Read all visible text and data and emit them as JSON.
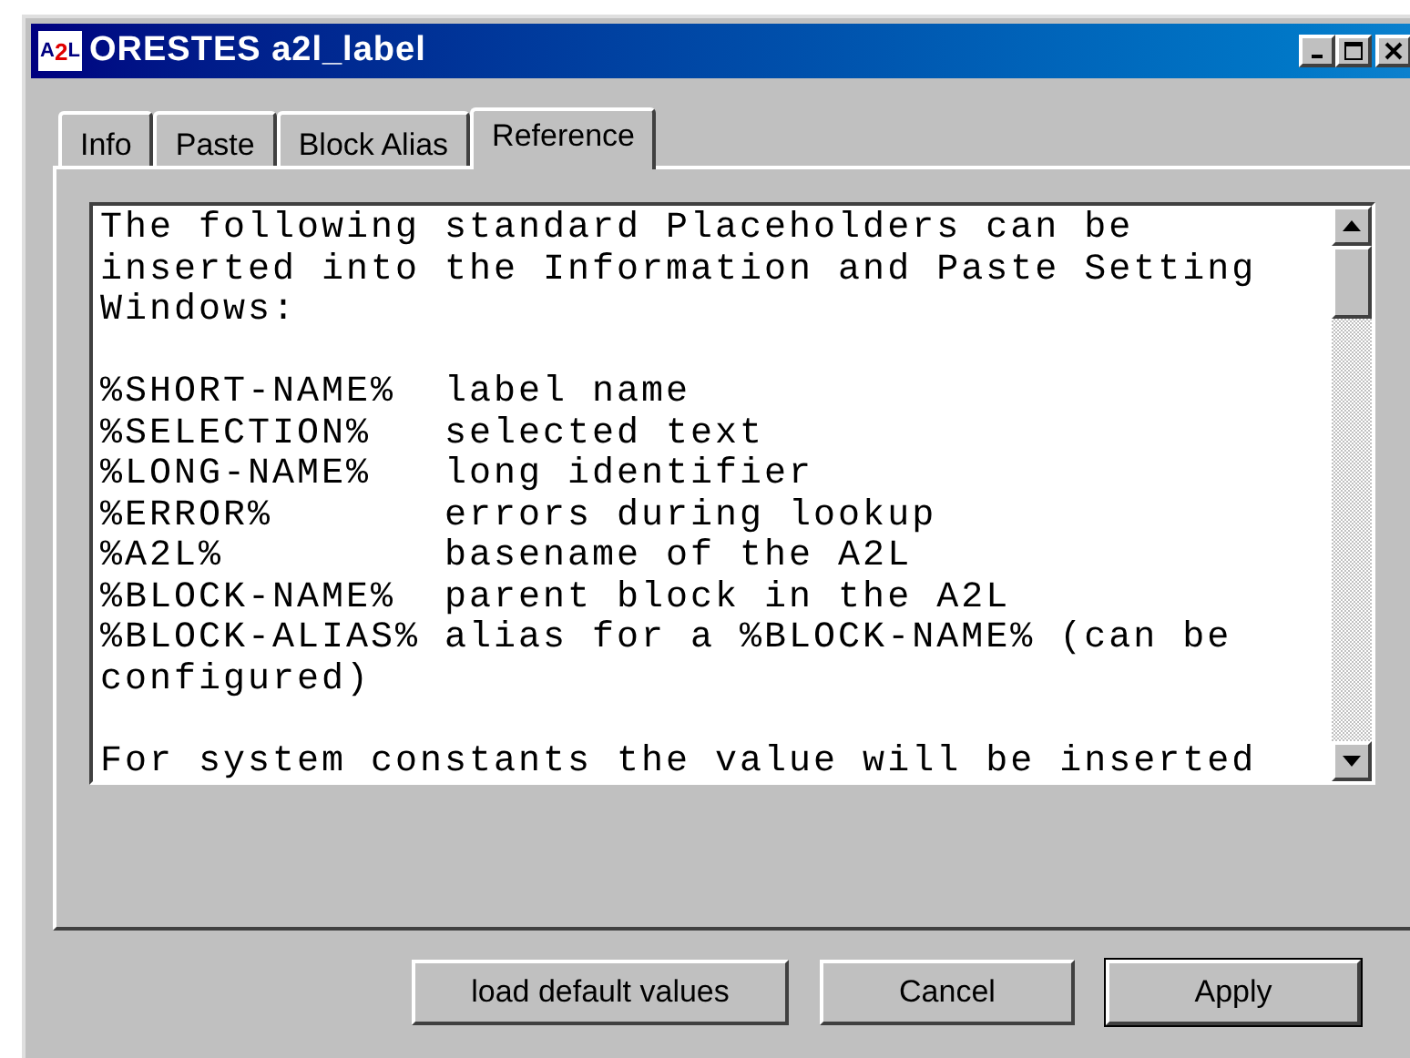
{
  "window": {
    "title": "ORESTES a2l_label",
    "app_icon": "A2L"
  },
  "tabs": [
    {
      "label": "Info",
      "selected": false
    },
    {
      "label": "Paste",
      "selected": false
    },
    {
      "label": "Block Alias",
      "selected": false
    },
    {
      "label": "Reference",
      "selected": true
    }
  ],
  "reference_text": {
    "paragraphs": [
      [
        "The following standard Placeholders can be",
        "inserted into the Information and Paste Setting",
        "Windows:"
      ],
      [
        "%SHORT-NAME%  label name",
        "%SELECTION%   selected text",
        "%LONG-NAME%   long identifier",
        "%ERROR%       errors during lookup",
        "%A2L%         basename of the A2L",
        "%BLOCK-NAME%  parent block in the A2L",
        "%BLOCK-ALIAS% alias for a %BLOCK-NAME% (can be",
        "configured)"
      ],
      [
        "For system constants the value will be inserted"
      ]
    ]
  },
  "buttons": [
    {
      "label": "load default values",
      "default": false
    },
    {
      "label": "Cancel",
      "default": false
    },
    {
      "label": "Apply",
      "default": true
    }
  ]
}
